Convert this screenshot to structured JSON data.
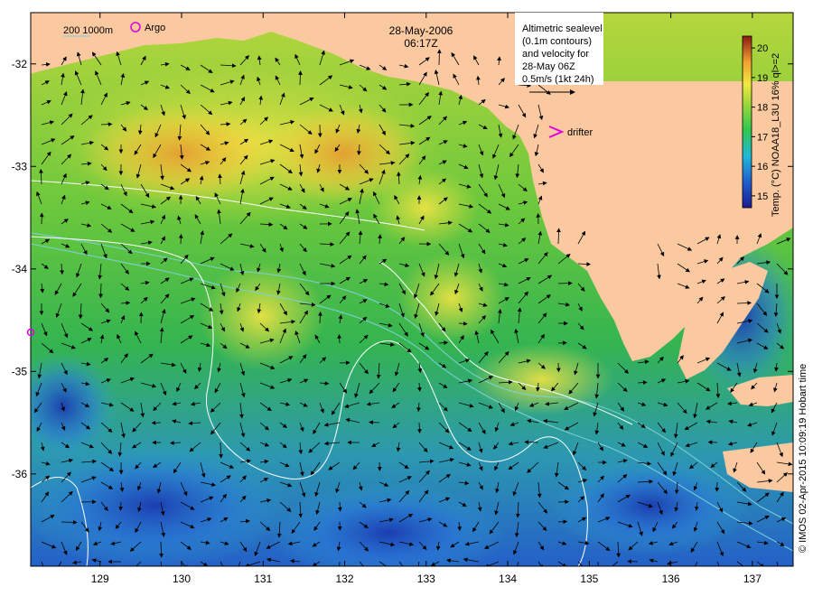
{
  "header": {
    "date": "28-May-2006",
    "time": "06:17Z"
  },
  "legend": {
    "isobath_label": "200  1000m",
    "argo_label": "Argo",
    "drifter_label": "drifter",
    "info_lines": [
      "Altimetric sealevel",
      "(0.1m contours)",
      "and velocity for",
      "28-May 06Z",
      "0.5m/s (1kt 24h)"
    ]
  },
  "colorbar": {
    "title": "Temp. (°C) NOAA18_L3U 16% ql>=2",
    "ticks": [
      "15",
      "16",
      "17",
      "18",
      "19",
      "20"
    ],
    "min": 14.6,
    "max": 20.4
  },
  "credit": "© IMOS 02-Apr-2015 10:09:19 Hobart time",
  "axes": {
    "x_ticks": [
      "129",
      "130",
      "131",
      "132",
      "133",
      "134",
      "135",
      "136",
      "137"
    ],
    "x_values": [
      129,
      130,
      131,
      132,
      133,
      134,
      135,
      136,
      137
    ],
    "y_ticks": [
      "-32",
      "-33",
      "-34",
      "-35",
      "-36"
    ],
    "y_values": [
      -32,
      -33,
      -34,
      -35,
      -36
    ],
    "lon_range": [
      128.15,
      137.5
    ],
    "lat_range": [
      -36.9,
      -31.5
    ]
  },
  "colors": {
    "land": "#fac9a0",
    "isobath": "#7fd0d8",
    "contour": "#ffffff",
    "argo": "#e000e0",
    "drifter": "#e000e0"
  }
}
